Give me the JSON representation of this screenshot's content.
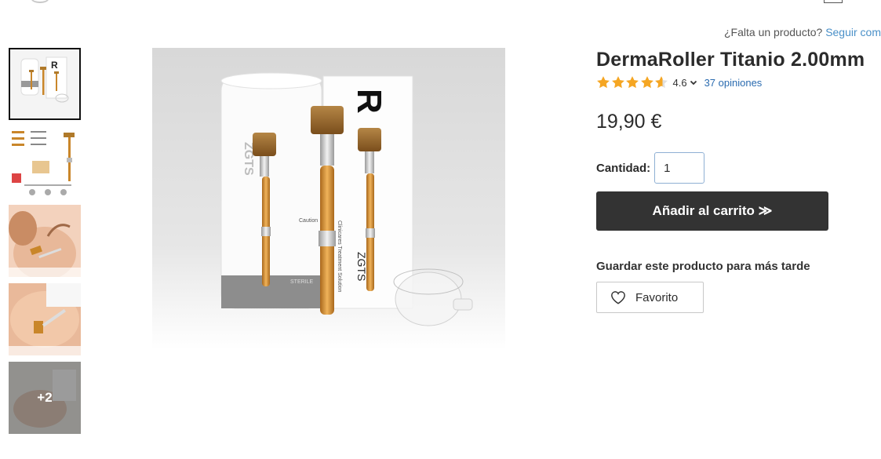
{
  "header": {
    "missing_question": "¿Falta un producto?",
    "missing_link": "Seguir com"
  },
  "gallery": {
    "thumbnails": [
      {
        "label": "Producto DermaRoller con caja"
      },
      {
        "label": "Detalles del rodillo"
      },
      {
        "label": "Uso en el rostro"
      },
      {
        "label": "Uso en el abdomen"
      },
      {
        "label": "Tratamiento facial"
      }
    ],
    "more_count": "+2",
    "main_alt": "DermaRoller ZGTS Clinicares Treatment Solution"
  },
  "product": {
    "title": "DermaRoller Titanio 2.00mm",
    "rating": "4.6",
    "rating_value": 4.6,
    "reviews": "37 opiniones",
    "price": "19,90 €",
    "quantity_label": "Cantidad:",
    "quantity_value": "1",
    "add_to_cart": "Añadir al carrito ≫",
    "save_later": "Guardar este producto para más tarde",
    "favorite": "Favorito"
  },
  "packaging_text": {
    "brand": "ZGTS",
    "sub": "Clinicares Treatment Solution",
    "caution": "Caution",
    "box_letter": "R",
    "sterile": "STERILE"
  },
  "colors": {
    "star": "#f5a623",
    "button_bg": "#333333",
    "link": "#2a6bb0",
    "roller_gold": "#c9862a"
  }
}
